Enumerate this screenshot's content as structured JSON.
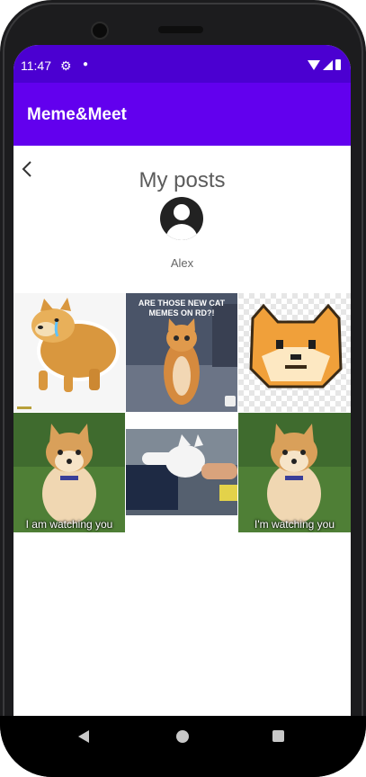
{
  "status_bar": {
    "time": "11:47",
    "settings_icon": "gear-icon"
  },
  "app_bar": {
    "title": "Meme&Meet"
  },
  "page": {
    "title": "My posts",
    "username": "Alex"
  },
  "posts": [
    {
      "caption": "",
      "image": "crying-doge-sticker"
    },
    {
      "caption": "ARE THOSE NEW CAT MEMES ON RD?!",
      "image": "cat-standing-meme"
    },
    {
      "caption": "",
      "image": "pixel-doge"
    },
    {
      "caption": "I am watching you",
      "image": "shiba-sitting-grass"
    },
    {
      "caption": "",
      "image": "cat-stretched-arm"
    },
    {
      "caption": "I'm watching you",
      "image": "shiba-sitting-grass"
    }
  ],
  "nav_bar": {
    "back_icon": "back-triangle-icon",
    "home_icon": "home-circle-icon",
    "recents_icon": "recents-square-icon"
  }
}
